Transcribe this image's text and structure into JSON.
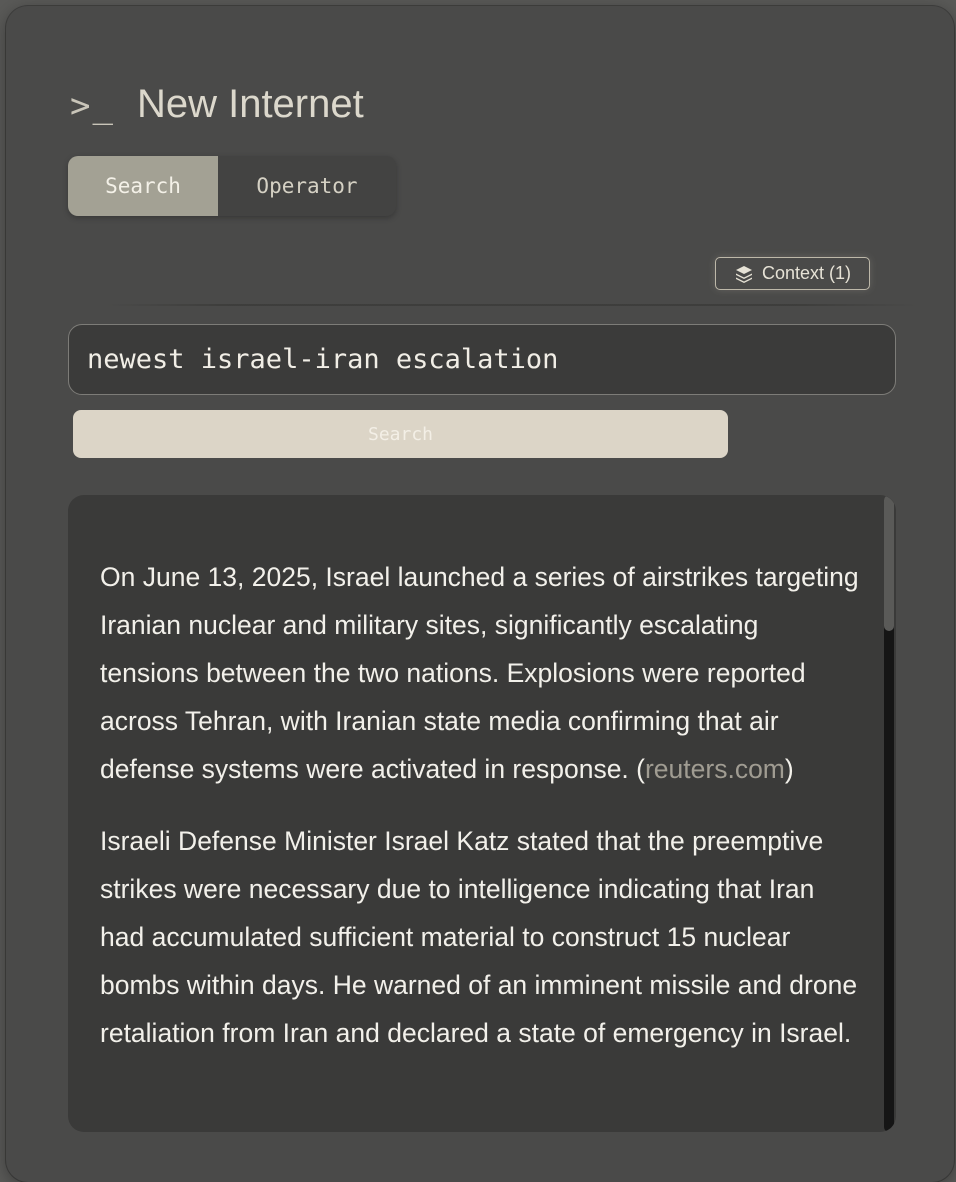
{
  "app": {
    "prompt_symbol": ">_",
    "title": "New Internet"
  },
  "mode_tabs": [
    {
      "label": "Search",
      "active": true
    },
    {
      "label": "Operator",
      "active": false
    }
  ],
  "context_button": {
    "icon": "layers-icon",
    "label": "Context (1)"
  },
  "search": {
    "query": "newest israel-iran escalation",
    "button_label": "Search"
  },
  "results": {
    "paragraph_1_text": "On June 13, 2025, Israel launched a series of airstrikes targeting Iranian nuclear and military sites, significantly escalating tensions between the two nations. Explosions were reported across Tehran, with Iranian state media confirming that air defense systems were activated in response. (",
    "paragraph_1_source": "reuters.com",
    "paragraph_1_close": ")",
    "paragraph_2_text": "Israeli Defense Minister Israel Katz stated that the preemptive strikes were necessary due to intelligence indicating that Iran had accumulated sufficient material to construct 15 nuclear bombs within days. He warned of an imminent missile and drone retaliation from Iran and declared a state of emergency in Israel."
  },
  "colors": {
    "background": "#4a4a49",
    "accent_tab": "#a3a194",
    "search_button": "#dcd5c7",
    "link": "#a09c92"
  }
}
